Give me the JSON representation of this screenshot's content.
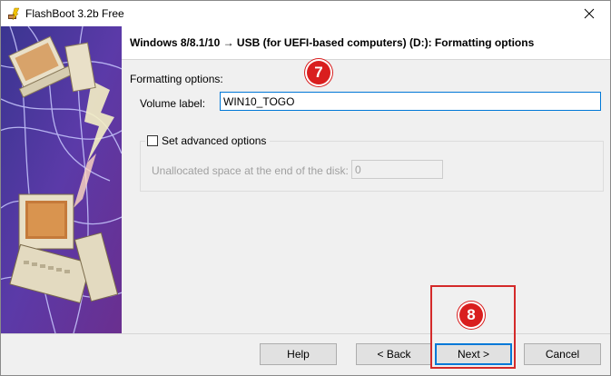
{
  "window": {
    "title": "FlashBoot 3.2b Free"
  },
  "header": {
    "title": "Windows 8/8.1/10 → USB (for UEFI-based computers) (D:): Formatting options"
  },
  "form": {
    "section_label": "Formatting options:",
    "volume_label": "Volume label:",
    "volume_value": "WIN10_TOGO",
    "advanced_label": "Set advanced options",
    "advanced_checked": false,
    "unallocated_label": "Unallocated space at the end of the disk:",
    "unallocated_value": "0"
  },
  "annotations": {
    "step7": "7",
    "step8": "8"
  },
  "buttons": {
    "help": "Help",
    "back": "< Back",
    "next": "Next >",
    "cancel": "Cancel"
  },
  "colors": {
    "accent": "#0078d7",
    "annotation_red": "#d91e1e"
  },
  "icons": {
    "app": "flashboot-icon",
    "close": "close-icon",
    "sidebar": "computer-illustration"
  }
}
